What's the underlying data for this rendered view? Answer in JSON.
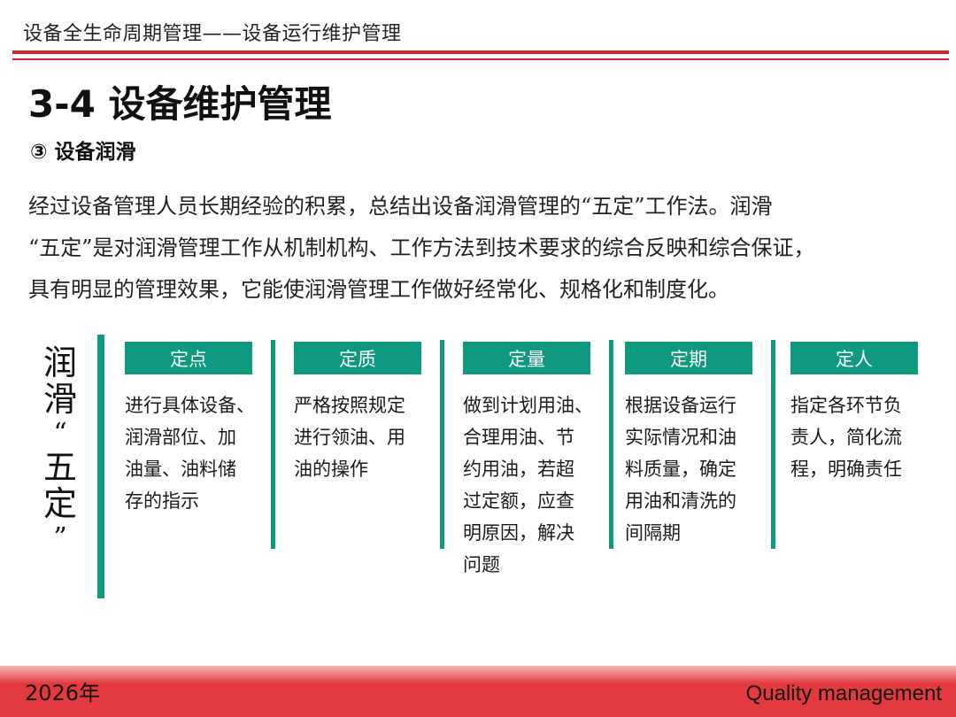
{
  "header": {
    "title": "设备全生命周期管理——设备运行维护管理"
  },
  "section": {
    "title": "3-4 设备维护管理",
    "subtitle": "③ 设备润滑"
  },
  "intro": {
    "lines": [
      "经过设备管理人员长期经验的积累，总结出设备润滑管理的“五定”工作法。润滑",
      "“五定”是对润滑管理工作从机制机构、工作方法到技术要求的综合反映和综合保证，",
      "具有明显的管理效果，它能使润滑管理工作做好经常化、规格化和制度化。"
    ]
  },
  "side_label": {
    "chars": [
      "润",
      "滑",
      "“",
      "五",
      "定",
      "”"
    ]
  },
  "columns": [
    {
      "tag": "定点",
      "lines": [
        "进行具体设备、",
        "润滑部位、加",
        "油量、油料储",
        "存的指示"
      ]
    },
    {
      "tag": "定质",
      "lines": [
        "严格按照规定",
        "进行领油、用",
        "油的操作"
      ]
    },
    {
      "tag": "定量",
      "lines": [
        "做到计划用油、",
        "合理用油、节",
        "约用油，若超",
        "过定额，应查",
        "明原因，解决",
        "问题"
      ]
    },
    {
      "tag": "定期",
      "lines": [
        "根据设备运行",
        "实际情况和油",
        "料质量，确定",
        "用油和清洗的",
        "间隔期"
      ]
    },
    {
      "tag": "定人",
      "lines": [
        "指定各环节负",
        "责人，简化流",
        "程，明确责任"
      ]
    }
  ],
  "footer": {
    "year": "2026年",
    "tagline": "Quality management"
  },
  "colors": {
    "accent_red": "#d9232e",
    "teal": "#0f9a80",
    "footer_red": "#e23a3f"
  }
}
